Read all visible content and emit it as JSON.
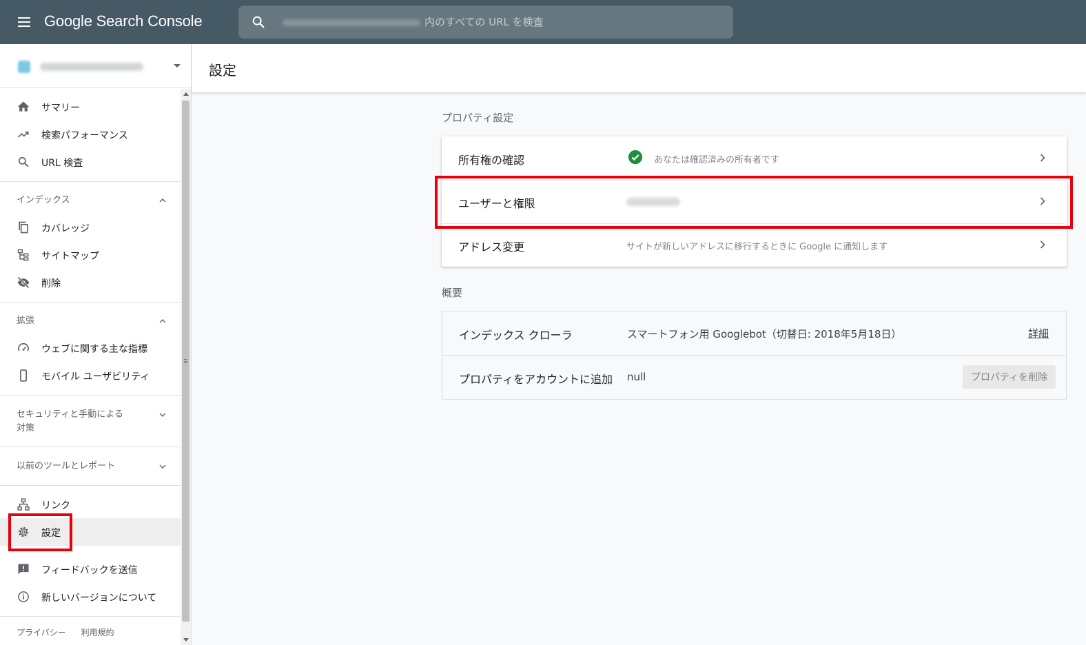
{
  "app": {
    "title": "Google Search Console"
  },
  "search": {
    "placeholder": "内のすべての URL を検査"
  },
  "header": {
    "page_title": "設定"
  },
  "sidebar": {
    "main_items": [
      {
        "label": "サマリー",
        "icon": "home-icon"
      },
      {
        "label": "検索パフォーマンス",
        "icon": "trending-up-icon"
      },
      {
        "label": "URL 検査",
        "icon": "search-icon"
      }
    ],
    "sections": [
      {
        "title": "インデックス",
        "expanded": true,
        "items": [
          {
            "label": "カバレッジ",
            "icon": "copy-icon"
          },
          {
            "label": "サイトマップ",
            "icon": "sitemap-icon"
          },
          {
            "label": "削除",
            "icon": "visibility-off-icon"
          }
        ]
      },
      {
        "title": "拡張",
        "expanded": true,
        "items": [
          {
            "label": "ウェブに関する主な指標",
            "icon": "speed-icon"
          },
          {
            "label": "モバイル ユーザビリティ",
            "icon": "smartphone-icon"
          }
        ]
      },
      {
        "title": "セキュリティと手動による",
        "title_line2": "対策",
        "expanded": false
      },
      {
        "title": "以前のツールとレポート",
        "expanded": false
      }
    ],
    "bottom_items": [
      {
        "label": "リンク",
        "icon": "links-icon"
      },
      {
        "label": "設定",
        "icon": "gear-icon",
        "active": true
      }
    ],
    "extra_items": [
      {
        "label": "フィードバックを送信",
        "icon": "feedback-icon"
      },
      {
        "label": "新しいバージョンについて",
        "icon": "info-icon"
      }
    ],
    "footer": {
      "privacy": "プライバシー",
      "terms": "利用規約"
    }
  },
  "settings": {
    "property_section_title": "プロパティ設定",
    "rows": [
      {
        "label": "所有権の確認",
        "value": "あなたは確認済みの所有者です",
        "status_icon": "check-circle-icon"
      },
      {
        "label": "ユーザーと権限"
      },
      {
        "label": "アドレス変更",
        "value": "サイトが新しいアドレスに移行するときに Google に通知します"
      }
    ],
    "overview_section_title": "概要",
    "overview_rows": [
      {
        "label": "インデックス クローラ",
        "value": "スマートフォン用 Googlebot（切替日: 2018年5月18日）",
        "link": "詳細"
      },
      {
        "label": "プロパティをアカウントに追加",
        "value": "null",
        "button": "プロパティを削除"
      }
    ]
  },
  "colors": {
    "topbar": "#455a64",
    "highlight": "#e8000b",
    "check": "#1e8e3e"
  }
}
